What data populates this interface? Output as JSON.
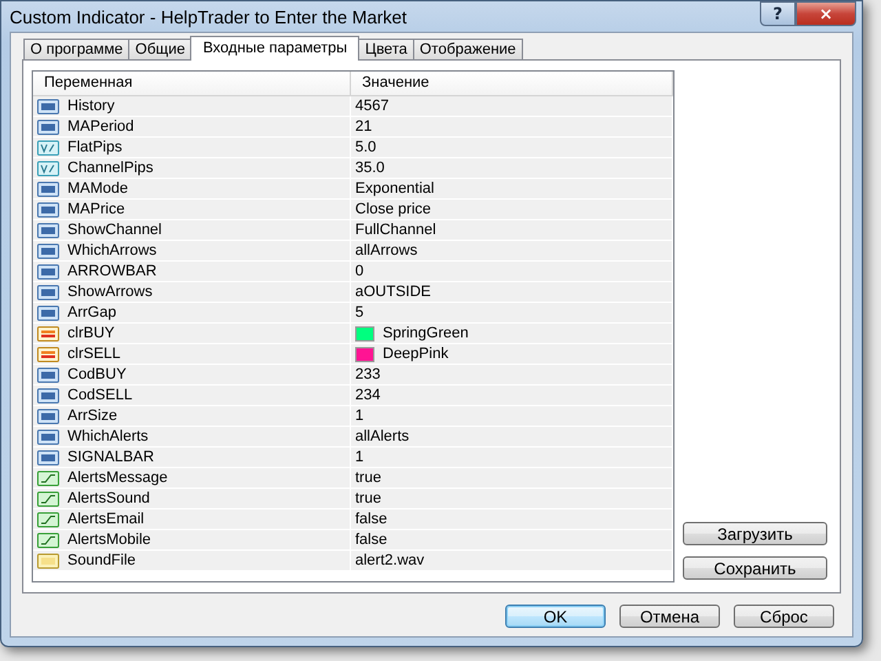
{
  "window": {
    "title": "Custom Indicator - HelpTrader to Enter the Market",
    "help_button": "?",
    "close_button": "×"
  },
  "tabs": [
    {
      "label": "О программе",
      "selected": false
    },
    {
      "label": "Общие",
      "selected": false
    },
    {
      "label": "Входные параметры",
      "selected": true
    },
    {
      "label": "Цвета",
      "selected": false
    },
    {
      "label": "Отображение",
      "selected": false
    }
  ],
  "table": {
    "columns": [
      "Переменная",
      "Значение"
    ],
    "rows": [
      {
        "kind": "int",
        "name": "History",
        "value": "4567"
      },
      {
        "kind": "int",
        "name": "MAPeriod",
        "value": "21"
      },
      {
        "kind": "double",
        "name": "FlatPips",
        "value": "5.0"
      },
      {
        "kind": "double",
        "name": "ChannelPips",
        "value": "35.0"
      },
      {
        "kind": "int",
        "name": "MAMode",
        "value": "Exponential"
      },
      {
        "kind": "int",
        "name": "MAPrice",
        "value": "Close price"
      },
      {
        "kind": "int",
        "name": "ShowChannel",
        "value": "FullChannel"
      },
      {
        "kind": "int",
        "name": "WhichArrows",
        "value": "allArrows"
      },
      {
        "kind": "int",
        "name": "ARROWBAR",
        "value": "0"
      },
      {
        "kind": "int",
        "name": "ShowArrows",
        "value": "aOUTSIDE"
      },
      {
        "kind": "int",
        "name": "ArrGap",
        "value": "5"
      },
      {
        "kind": "color",
        "name": "clrBUY",
        "value": "SpringGreen",
        "color": "#00ff7f"
      },
      {
        "kind": "color",
        "name": "clrSELL",
        "value": "DeepPink",
        "color": "#ff1493"
      },
      {
        "kind": "int",
        "name": "CodBUY",
        "value": "233"
      },
      {
        "kind": "int",
        "name": "CodSELL",
        "value": "234"
      },
      {
        "kind": "int",
        "name": "ArrSize",
        "value": "1"
      },
      {
        "kind": "int",
        "name": "WhichAlerts",
        "value": "allAlerts"
      },
      {
        "kind": "int",
        "name": "SIGNALBAR",
        "value": "1"
      },
      {
        "kind": "bool",
        "name": "AlertsMessage",
        "value": "true"
      },
      {
        "kind": "bool",
        "name": "AlertsSound",
        "value": "true"
      },
      {
        "kind": "bool",
        "name": "AlertsEmail",
        "value": "false"
      },
      {
        "kind": "bool",
        "name": "AlertsMobile",
        "value": "false"
      },
      {
        "kind": "string",
        "name": "SoundFile",
        "value": "alert2.wav"
      }
    ]
  },
  "side_buttons": [
    "Загрузить",
    "Сохранить"
  ],
  "buttons": [
    {
      "label": "OK",
      "default": true
    },
    {
      "label": "Отмена",
      "default": false
    },
    {
      "label": "Сброс",
      "default": false
    }
  ]
}
